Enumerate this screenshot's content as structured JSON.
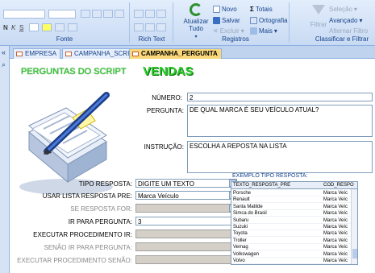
{
  "ribbon": {
    "groups": {
      "fonte": "Fonte",
      "rich_text": "Rich Text",
      "registros": "Registros",
      "classificar": "Classificar e Filtrar"
    },
    "atualizar_label": "Atualizar Tudo",
    "atualizar_caret": "▾",
    "registros_buttons": {
      "novo": "Novo",
      "salvar": "Salvar",
      "excluir": "Excluir",
      "totais": "Totais",
      "ortografia": "Ortografia",
      "mais": "Mais"
    },
    "filtro": {
      "filtrar": "Filtrar",
      "selecao": "Seleção",
      "avancado": "Avançado",
      "alternar": "Alternar Filtro"
    },
    "caret": "▾",
    "fmt": {
      "bold": "N",
      "italic": "K",
      "underline": "S"
    }
  },
  "tabs": [
    {
      "label": "EMPRESA"
    },
    {
      "label": "CAMPANHA_SCRIPT"
    },
    {
      "label": "CAMPANHA_PERGUNTA"
    }
  ],
  "form": {
    "title_script": "PERGUNTAS DO SCRIPT",
    "title_vendas": "VENDAS",
    "numero_label": "NÚMERO:",
    "numero_value": "2",
    "pergunta_label": "PERGUNTA:",
    "pergunta_value": "DE QUAL MARCA É SEU VEÍCULO ATUAL?",
    "instrucao_label": "INSTRUÇÃO:",
    "instrucao_value": "ESCOLHA A REPOSTA NA LISTA",
    "tipo_label": "TIPO RESPOSTA:",
    "tipo_value": "DIGITE UM TEXTO",
    "usar_label": "USAR LISTA RESPOSTA PRE:",
    "usar_value": "Marca Veículo",
    "se_label": "SE RESPOSTA FOR:",
    "se_value": "",
    "ir_label": "IR PARA PERGUNTA:",
    "ir_value": "3",
    "exec_label": "EXECUTAR PROCEDIMENTO IR:",
    "exec_value": "",
    "senao_ir_label": "SENÃO IR PARA PERGUNTA:",
    "senao_ir_value": "",
    "exec_senao_label": "EXECUTAR PROCEDIMENTO SENÃO:",
    "exec_senao_value": ""
  },
  "exemplo": {
    "title": "EXEMPLO TIPO RESPOSTA:",
    "col1": "TEXTO_RESPOSTA_PRE",
    "col2": "COD_RESPO",
    "rows": [
      [
        "Porsche",
        "Marca Veíc"
      ],
      [
        "Renault",
        "Marca Veíc"
      ],
      [
        "Santa Matilde",
        "Marca Veíc"
      ],
      [
        "Simca do Brasil",
        "Marca Veíc"
      ],
      [
        "Subaru",
        "Marca Veíc"
      ],
      [
        "Suzuki",
        "Marca Veíc"
      ],
      [
        "Toyota",
        "Marca Veíc"
      ],
      [
        "Troller",
        "Marca Veíc"
      ],
      [
        "Vemag",
        "Marca Veíc"
      ],
      [
        "Volkswagen",
        "Marca Veíc"
      ],
      [
        "Volvo",
        "Marca Veíc"
      ]
    ]
  },
  "leftbar": {
    "collapse": "«",
    "search": "⌕"
  },
  "colors": {
    "title_green": "#2ecc2e",
    "accent": "#15428b",
    "active_tab": "#f9d77a"
  }
}
